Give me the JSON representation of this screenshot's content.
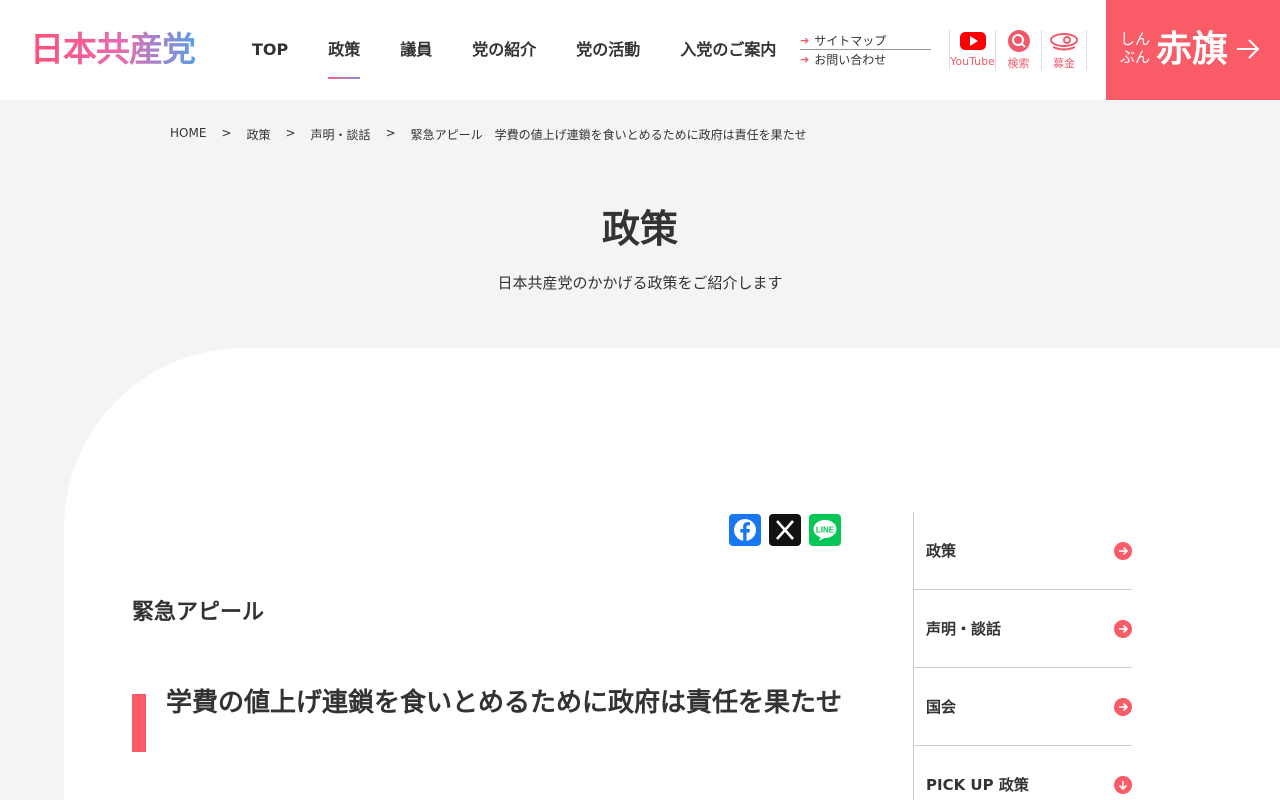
{
  "header": {
    "logo": "日本共産党",
    "nav": [
      "TOP",
      "政策",
      "議員",
      "党の紹介",
      "党の活動",
      "入党のご案内"
    ],
    "active_nav": "政策",
    "utility_links": [
      "サイトマップ",
      "お問い合わせ"
    ],
    "icons": [
      {
        "name": "youtube-icon",
        "label": "YouTube"
      },
      {
        "name": "search-icon",
        "label": "検索"
      },
      {
        "name": "bokin-icon",
        "label": "募金"
      }
    ],
    "akahata": {
      "small_line1": "しん",
      "small_line2": "ぶん",
      "big": "赤旗"
    }
  },
  "breadcrumb": [
    "HOME",
    "政策",
    "声明・談話",
    "緊急アピール　学費の値上げ連鎖を食いとめるために政府は責任を果たせ"
  ],
  "breadcrumb_sep": ">",
  "page": {
    "title": "政策",
    "subtitle": "日本共産党のかかげる政策をご紹介します"
  },
  "article": {
    "category": "緊急アピール",
    "title": "学費の値上げ連鎖を食いとめるために政府は責任を果たせ"
  },
  "share": [
    "Facebook",
    "X",
    "LINE"
  ],
  "sidebar": [
    {
      "label": "政策",
      "arrow": "right"
    },
    {
      "label": "声明・談話",
      "arrow": "right"
    },
    {
      "label": "国会",
      "arrow": "right"
    },
    {
      "label": "PICK UP 政策",
      "arrow": "down"
    }
  ],
  "colors": {
    "accent": "#fa5c67",
    "facebook": "#1877f2",
    "line": "#06c755",
    "x": "#111111"
  }
}
